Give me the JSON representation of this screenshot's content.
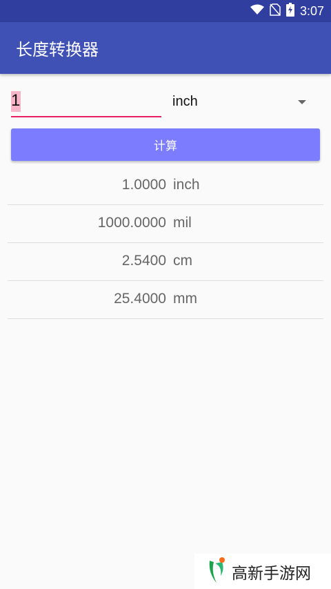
{
  "status_bar": {
    "time": "3:07",
    "icons": [
      "wifi-icon",
      "no-sim-icon",
      "battery-charging-icon"
    ]
  },
  "app_bar": {
    "title": "长度转换器"
  },
  "converter": {
    "input_value": "1",
    "unit_selected": "inch",
    "calculate_label": "计算"
  },
  "results": [
    {
      "value": "1.0000",
      "unit": "inch"
    },
    {
      "value": "1000.0000",
      "unit": "mil"
    },
    {
      "value": "2.5400",
      "unit": "cm"
    },
    {
      "value": "25.4000",
      "unit": "mm"
    }
  ],
  "watermark": {
    "text": "高新手游网"
  },
  "colors": {
    "status_bar": "#303f9f",
    "app_bar": "#3f51b5",
    "accent": "#e91e63",
    "button": "#7c7cff"
  }
}
